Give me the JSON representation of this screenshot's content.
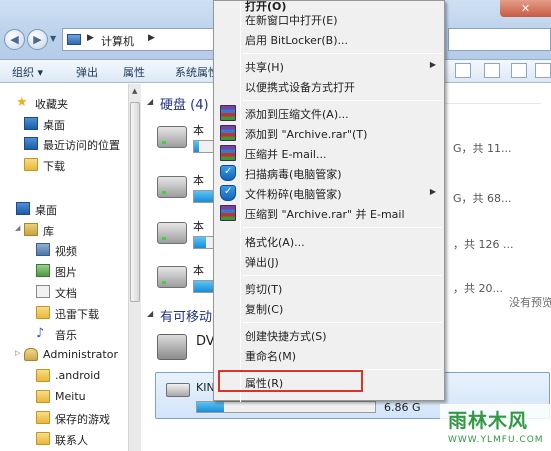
{
  "window": {
    "breadcrumb": "计算机",
    "close_glyph": "✕"
  },
  "toolbar": {
    "organize": "组织 ▾",
    "eject": "弹出",
    "properties": "属性",
    "system_props": "系统属性"
  },
  "sidebar": {
    "favorites_header": "收藏夹",
    "favorites": [
      "桌面",
      "最近访问的位置",
      "下载"
    ],
    "desktop": "桌面",
    "library": "库",
    "libraries": [
      "视频",
      "图片",
      "文档",
      "迅雷下载",
      "音乐"
    ],
    "user": "Administrator",
    "user_folders": [
      ".android",
      "Meitu",
      "保存的游戏",
      "联系人"
    ]
  },
  "main": {
    "hard_disks_header": "硬盘 (4)",
    "drives": [
      {
        "name": "本",
        "free": "G，共 11...",
        "fill": 0.02
      },
      {
        "name": "本",
        "free": "G，共 68...",
        "fill": 0.9
      },
      {
        "name": "本",
        "free": "，共 126 ...",
        "fill": 0.05
      },
      {
        "name": "本",
        "free": "，共 20...",
        "fill": 0.95
      }
    ],
    "removable_header": "有可移动",
    "dvd_label": "DV",
    "kin": {
      "name": "KIN",
      "free": "6.86 G",
      "fill": 0.15
    },
    "preview_text": "没有预览"
  },
  "context_menu": {
    "items": [
      {
        "label": "打开(O)",
        "icon": ""
      },
      {
        "label": "在新窗口中打开(E)",
        "icon": ""
      },
      {
        "label": "启用 BitLocker(B)...",
        "icon": ""
      },
      {
        "label": "共享(H)",
        "icon": "",
        "submenu": true
      },
      {
        "label": "以便携式设备方式打开",
        "icon": ""
      },
      {
        "label": "添加到压缩文件(A)...",
        "icon": "winrar-icon"
      },
      {
        "label": "添加到 \"Archive.rar\"(T)",
        "icon": "winrar-icon"
      },
      {
        "label": "压缩并 E-mail...",
        "icon": "winrar-icon"
      },
      {
        "label": "扫描病毒(电脑管家)",
        "icon": "shield-icon"
      },
      {
        "label": "文件粉碎(电脑管家)",
        "icon": "shield-icon",
        "submenu": true
      },
      {
        "label": "压缩到 \"Archive.rar\" 并 E-mail",
        "icon": "winrar-icon"
      },
      {
        "label": "格式化(A)...",
        "icon": ""
      },
      {
        "label": "弹出(J)",
        "icon": ""
      },
      {
        "label": "剪切(T)",
        "icon": ""
      },
      {
        "label": "复制(C)",
        "icon": ""
      },
      {
        "label": "创建快捷方式(S)",
        "icon": ""
      },
      {
        "label": "重命名(M)",
        "icon": ""
      },
      {
        "label": "属性(R)",
        "icon": ""
      }
    ],
    "submenu_arrow": "▶"
  },
  "watermark": {
    "logo": "雨林木风",
    "url": "WWW.YLMFU.COM"
  },
  "colors": {
    "highlight_border": "#d9342b",
    "drive_bar": "#1c8bd6"
  }
}
